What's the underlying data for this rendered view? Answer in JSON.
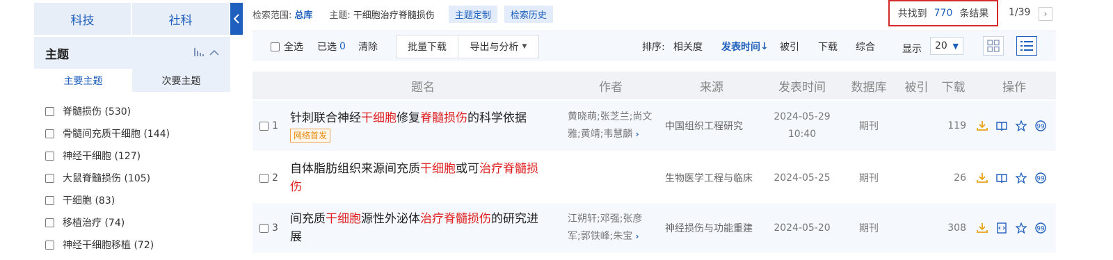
{
  "left": {
    "tabs": [
      "科技",
      "社科"
    ],
    "section_title": "主题",
    "section_icons": [
      "bar-chart-icon",
      "chevron-up-icon"
    ],
    "subtabs": [
      "主要主题",
      "次要主题"
    ],
    "topics": [
      {
        "label": "脊髓损伤 (530)"
      },
      {
        "label": "骨髓间充质干细胞 (144)"
      },
      {
        "label": "神经干细胞 (127)"
      },
      {
        "label": "大鼠脊髓损伤 (105)"
      },
      {
        "label": "干细胞 (83)"
      },
      {
        "label": "移植治疗 (74)"
      },
      {
        "label": "神经干细胞移植 (72)"
      }
    ]
  },
  "crumbs": {
    "scope_label": "检索范围:",
    "scope_value": "总库",
    "topic_label": "主题:",
    "topic_value": "干细胞治疗脊髓损伤",
    "custom_label": "主题定制",
    "history_label": "检索历史"
  },
  "result": {
    "prefix": "共找到",
    "count": "770",
    "suffix": "条结果"
  },
  "pagination": {
    "page": "1/39",
    "next": "›"
  },
  "toolbar": {
    "select_all": "全选",
    "selected_label": "已选",
    "selected_count": "0",
    "clear": "清除",
    "batch_download": "批量下载",
    "export": "导出与分析",
    "sort_label": "排序:",
    "sort_options": [
      "相关度",
      "发表时间",
      "被引",
      "下载",
      "综合"
    ],
    "sort_active_arrow": "↓",
    "display_label": "显示",
    "display_value": "20"
  },
  "columns": [
    "题名",
    "作者",
    "来源",
    "发表时间",
    "数据库",
    "被引",
    "下载",
    "操作"
  ],
  "rows": [
    {
      "num": "1",
      "title_parts": [
        [
          "针刺联合神经",
          false
        ],
        [
          "干细胞",
          true
        ],
        [
          "修复",
          false
        ],
        [
          "脊髓损伤",
          true
        ],
        [
          "的科学依据",
          false
        ]
      ],
      "tag": "网络首发",
      "authors": [
        "黄晓萌;张芝兰;尚文",
        "雅;黄靖;韦慧麟"
      ],
      "source": "中国组织工程研究",
      "date": [
        "2024-05-29",
        "10:40"
      ],
      "db": "期刊",
      "cited": "",
      "downloads": "119"
    },
    {
      "num": "2",
      "title_parts": [
        [
          "自体脂肪组织来源间充质",
          false
        ],
        [
          "干细胞",
          true
        ],
        [
          "或可",
          false
        ],
        [
          "治疗脊髓损",
          true
        ]
      ],
      "title_line2": [
        [
          "伤",
          true
        ]
      ],
      "tag": "",
      "authors": [],
      "source": "生物医学工程与临床",
      "date": [
        "2024-05-25"
      ],
      "db": "期刊",
      "cited": "",
      "downloads": "26"
    },
    {
      "num": "3",
      "title_parts": [
        [
          "间充质",
          false
        ],
        [
          "干细胞",
          true
        ],
        [
          "源性外泌体",
          false
        ],
        [
          "治疗脊髓损伤",
          true
        ],
        [
          "的研究进",
          false
        ]
      ],
      "title_line2": [
        [
          "展",
          false
        ]
      ],
      "tag": "",
      "authors": [
        "江朔轩;邓强;张彦",
        "军;郭铁峰;朱宝"
      ],
      "source": "神经损伤与功能重建",
      "date": [
        "2024-05-20"
      ],
      "db": "期刊",
      "cited": "",
      "downloads": "308"
    }
  ],
  "colors": {
    "accent": "#1f5fbd",
    "highlight": "#e02020",
    "result_border": "#d42a2a",
    "download_icon": "#e8a317"
  }
}
